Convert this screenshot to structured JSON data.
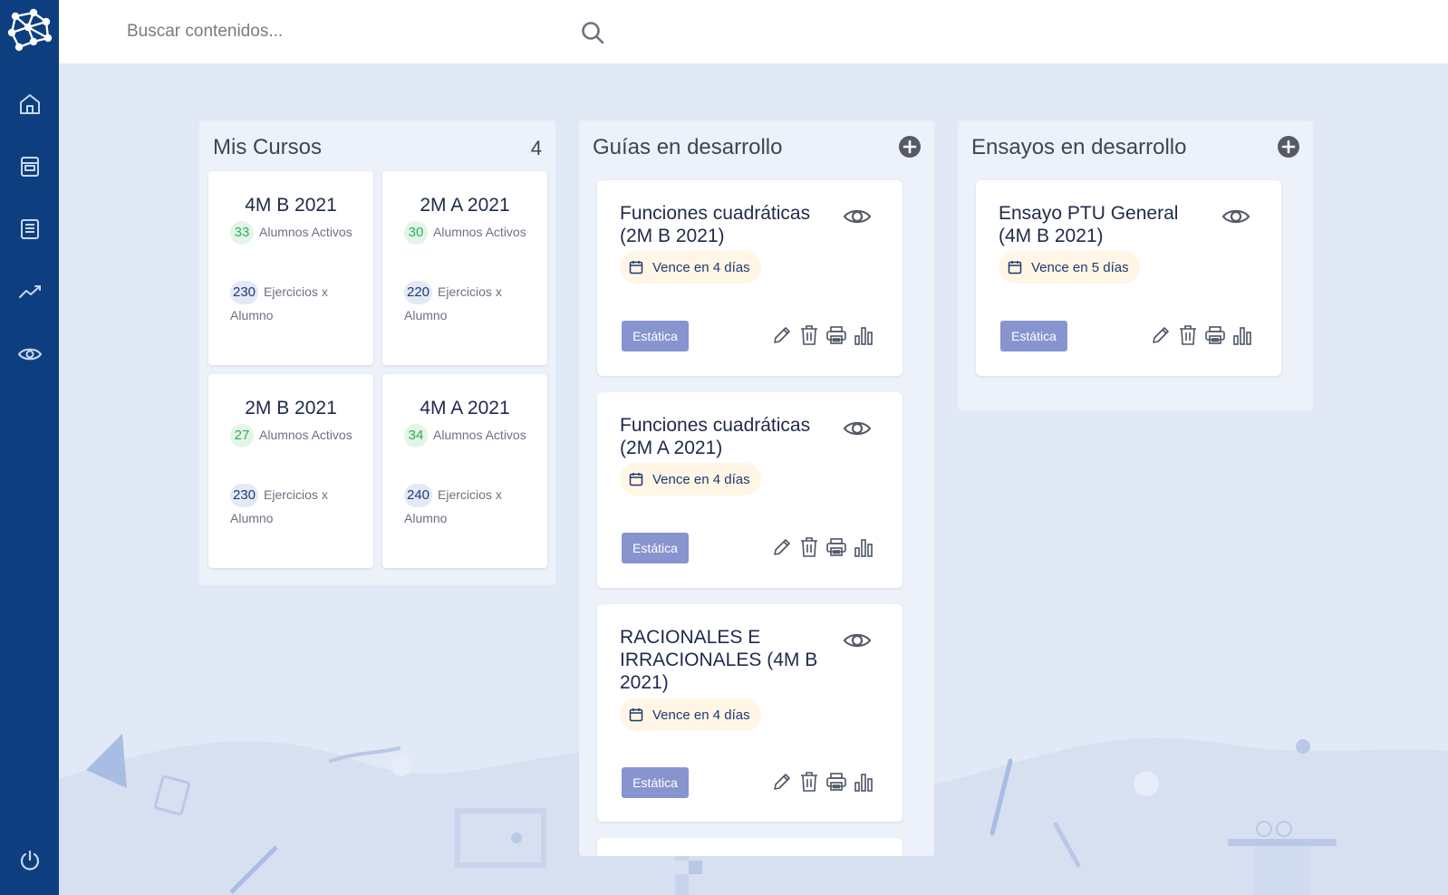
{
  "search": {
    "placeholder": "Buscar contenidos..."
  },
  "sidebar": {
    "logo_icon": "network-logo-icon",
    "items": [
      {
        "icon": "home-icon"
      },
      {
        "icon": "archive-icon"
      },
      {
        "icon": "list-document-icon"
      },
      {
        "icon": "trending-up-icon"
      },
      {
        "icon": "eye-icon"
      }
    ],
    "bottom_icon": "power-icon"
  },
  "cursos": {
    "title": "Mis Cursos",
    "count": "4",
    "cards": [
      {
        "title": "4M B 2021",
        "alumnos": "33",
        "alumnos_label": "Alumnos Activos",
        "ejercicios": "230",
        "ejercicios_label": "Ejercicios x Alumno"
      },
      {
        "title": "2M A 2021",
        "alumnos": "30",
        "alumnos_label": "Alumnos Activos",
        "ejercicios": "220",
        "ejercicios_label": "Ejercicios x Alumno"
      },
      {
        "title": "2M B 2021",
        "alumnos": "27",
        "alumnos_label": "Alumnos Activos",
        "ejercicios": "230",
        "ejercicios_label": "Ejercicios x Alumno"
      },
      {
        "title": "4M A 2021",
        "alumnos": "34",
        "alumnos_label": "Alumnos Activos",
        "ejercicios": "240",
        "ejercicios_label": "Ejercicios x Alumno"
      }
    ]
  },
  "guias": {
    "title": "Guías en desarrollo",
    "items": [
      {
        "title": "Funciones cuadráticas (2M B 2021)",
        "due": "Vence en 4 días",
        "type": "Estática"
      },
      {
        "title": "Funciones cuadráticas (2M A 2021)",
        "due": "Vence en 4 días",
        "type": "Estática"
      },
      {
        "title": "RACIONALES E IRRACIONALES (4M B 2021)",
        "due": "Vence en 4 días",
        "type": "Estática"
      }
    ]
  },
  "ensayos": {
    "title": "Ensayos en desarrollo",
    "items": [
      {
        "title": "Ensayo PTU General (4M B 2021)",
        "due": "Vence en 5 días",
        "type": "Estática"
      }
    ]
  },
  "colors": {
    "sidebar": "#0d3f80",
    "background": "#e1e9f6",
    "badge_type": "#8894cf",
    "badge_due": "#fff6e5",
    "pill_green": "#2fb055"
  }
}
